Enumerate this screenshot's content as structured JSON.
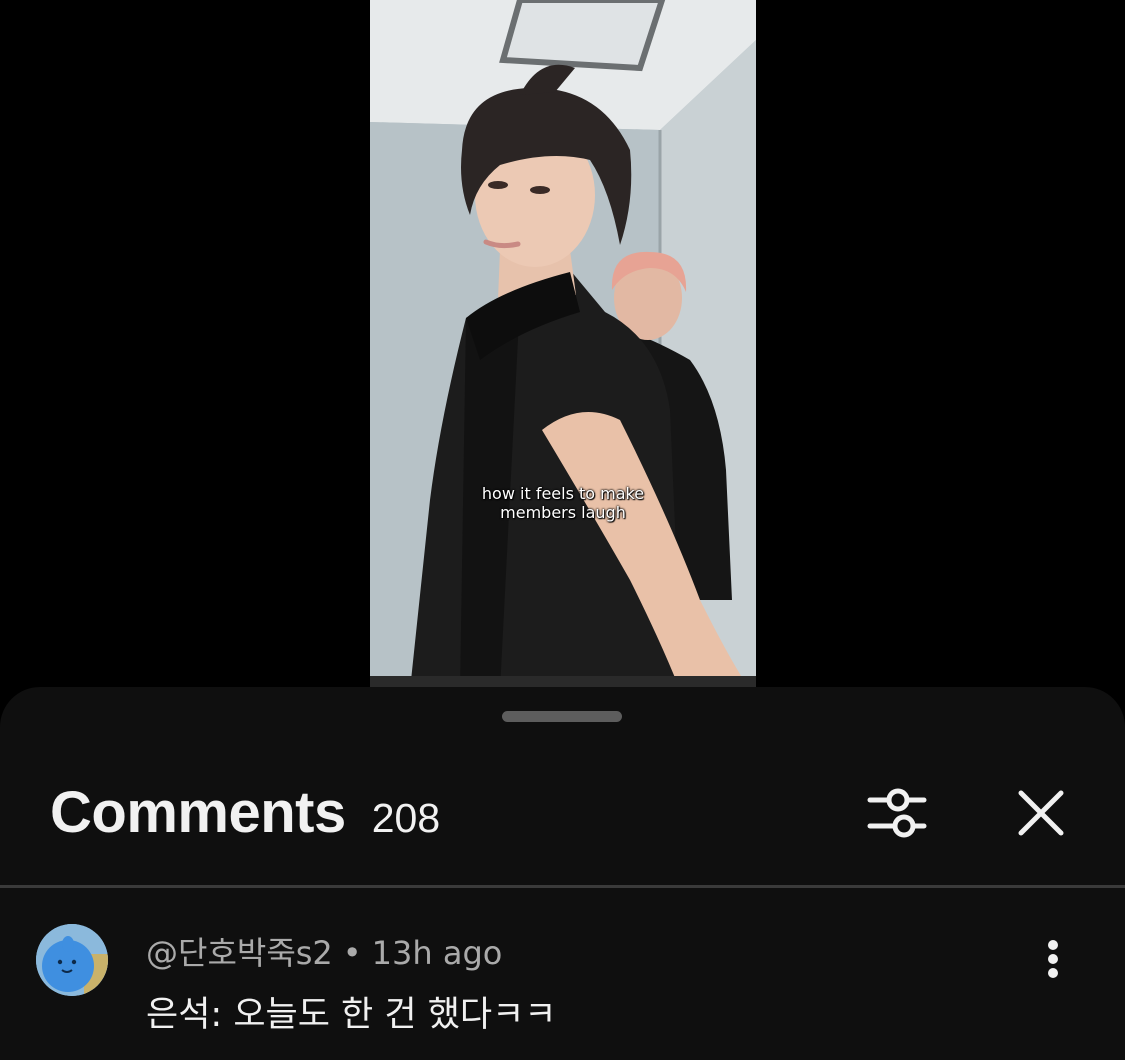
{
  "video": {
    "caption_line1": "how it feels to make",
    "caption_line2": "members laugh"
  },
  "comments_panel": {
    "title": "Comments",
    "count": "208",
    "filter_icon": "sort-filter-icon",
    "close_icon": "close-icon"
  },
  "comments": [
    {
      "author": "@단호박죽s2",
      "separator": "•",
      "time": "13h ago",
      "text": "은석: 오늘도 한 건 했다ㅋㅋ",
      "more_icon": "more-vertical-icon"
    }
  ],
  "colors": {
    "sheet_background": "#0f0f0f",
    "primary_text": "#f1f1f1",
    "secondary_text": "#aaaaaa"
  }
}
